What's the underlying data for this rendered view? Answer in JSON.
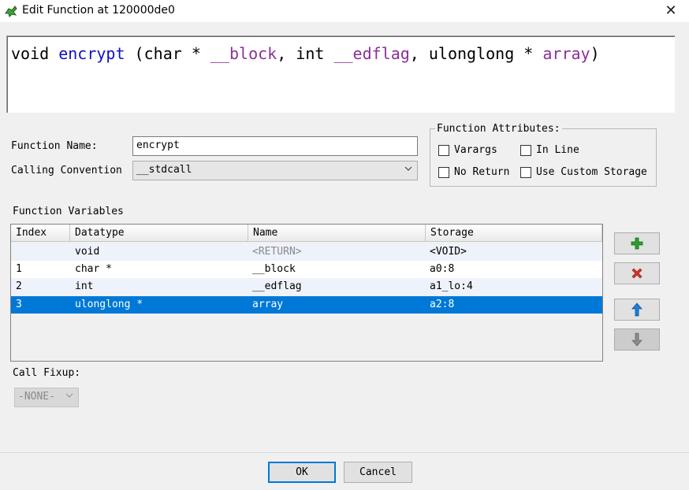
{
  "window": {
    "title": "Edit Function at 120000de0",
    "close_label": "✕"
  },
  "signature": {
    "return_type": "void",
    "name": "encrypt",
    "open": " (",
    "p1_type": "char * ",
    "p1_name": "__block",
    "sep1": ", ",
    "p2_type": "int ",
    "p2_name": "__edflag",
    "sep2": ", ",
    "p3_type": "ulonglong * ",
    "p3_name": "array",
    "close": ")"
  },
  "fields": {
    "function_name_label": "Function Name:",
    "function_name_value": "encrypt",
    "calling_convention_label": "Calling Convention",
    "calling_convention_value": "__stdcall"
  },
  "attributes": {
    "title": "Function Attributes:",
    "varargs": "Varargs",
    "inline": "In Line",
    "no_return": "No Return",
    "custom_storage": "Use Custom Storage"
  },
  "variables": {
    "title": "Function Variables",
    "columns": [
      "Index",
      "Datatype",
      "Name",
      "Storage"
    ],
    "rows": [
      {
        "index": "",
        "datatype": "void",
        "name": "<RETURN>",
        "storage": "<VOID>"
      },
      {
        "index": "1",
        "datatype": "char *",
        "name": "__block",
        "storage": "a0:8"
      },
      {
        "index": "2",
        "datatype": "int",
        "name": "__edflag",
        "storage": "a1_lo:4"
      },
      {
        "index": "3",
        "datatype": "ulonglong *",
        "name": "array",
        "storage": "a2:8"
      }
    ],
    "selected_row_index": 3
  },
  "call_fixup": {
    "label": "Call Fixup:",
    "value": "-NONE-"
  },
  "buttons": {
    "ok": "OK",
    "cancel": "Cancel"
  },
  "colors": {
    "accent": "#0078d7",
    "function_name": "#1010c8",
    "param_name": "#8b2f9a",
    "add_icon": "#2aa12a",
    "remove_icon": "#d93025",
    "up_icon": "#1e7fd8",
    "down_icon": "#8a8a8a"
  }
}
